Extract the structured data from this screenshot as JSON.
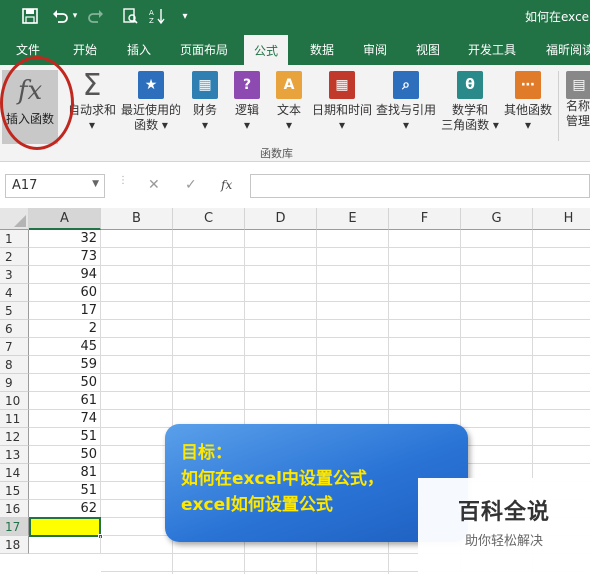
{
  "window_title": "如何在excel",
  "quick_access": {
    "save_icon": "save-icon",
    "undo_icon": "undo-icon",
    "redo_icon": "redo-icon",
    "preview_icon": "print-preview-icon",
    "sort_icon": "sort-icon",
    "customize_icon": "customize-qat-icon"
  },
  "tabs": [
    "文件",
    "开始",
    "插入",
    "页面布局",
    "公式",
    "数据",
    "审阅",
    "视图",
    "开发工具",
    "福昕阅读"
  ],
  "active_tab": "公式",
  "ribbon": {
    "insert_function": {
      "symbol": "fx",
      "label": "插入函数"
    },
    "buttons": [
      {
        "line1": "自动求和",
        "line2": "▾",
        "icon_text": "Σ"
      },
      {
        "line1": "最近使用的",
        "line2": "函数 ▾",
        "icon_text": "★"
      },
      {
        "line1": "财务",
        "line2": "▾",
        "icon_text": "▦"
      },
      {
        "line1": "逻辑",
        "line2": "▾",
        "icon_text": "?"
      },
      {
        "line1": "文本",
        "line2": "▾",
        "icon_text": "A"
      },
      {
        "line1": "日期和时间",
        "line2": "▾",
        "icon_text": "▦"
      },
      {
        "line1": "查找与引用",
        "line2": "▾",
        "icon_text": "⌕"
      },
      {
        "line1": "数学和",
        "line2": "三角函数 ▾",
        "icon_text": "θ"
      },
      {
        "line1": "其他函数",
        "line2": "▾",
        "icon_text": "⋯"
      },
      {
        "line1": "名称",
        "line2": "管理",
        "icon_text": "▤"
      }
    ],
    "group_label": "函数库",
    "colors": {
      "autosum": "#555555",
      "recent": "#2e6fbd",
      "financial": "#2f7fb3",
      "logical": "#8d4ab0",
      "text": "#e8a33d",
      "datetime": "#c0392b",
      "lookup": "#2e6fbd",
      "math": "#2a8a8a",
      "more": "#e07b2a",
      "names": "#888888"
    }
  },
  "formula_bar": {
    "name_box": "A17",
    "cancel_symbol": "✕",
    "enter_symbol": "✓",
    "fx_symbol": "fx",
    "value": ""
  },
  "grid": {
    "columns": [
      "A",
      "B",
      "C",
      "D",
      "E",
      "F",
      "G",
      "H"
    ],
    "rows": [
      "1",
      "2",
      "3",
      "4",
      "5",
      "6",
      "7",
      "8",
      "9",
      "10",
      "11",
      "12",
      "13",
      "14",
      "15",
      "16",
      "17",
      "18"
    ],
    "column_a_values": [
      "32",
      "73",
      "94",
      "60",
      "17",
      "2",
      "45",
      "59",
      "50",
      "61",
      "74",
      "51",
      "50",
      "81",
      "51",
      "62",
      "",
      ""
    ],
    "selected_cell": "A17",
    "selected_fill": "#ffff00"
  },
  "callout": {
    "line1": "目标：",
    "line2": "如何在excel中设置公式，",
    "line3": "excel如何设置公式"
  },
  "watermark": {
    "title": "百科全说",
    "subtitle": "助你轻松解决"
  }
}
